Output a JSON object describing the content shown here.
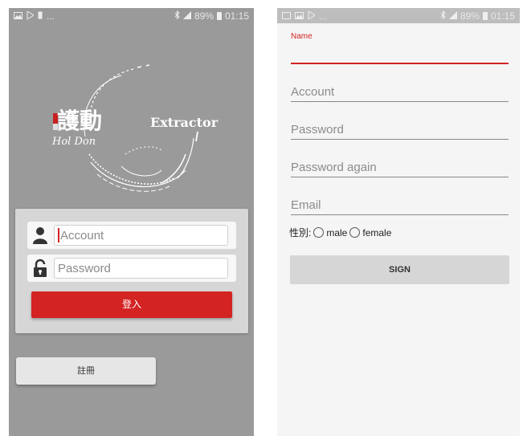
{
  "status_bar_left": {
    "battery": "89%",
    "time": "01:15",
    "dots": "..."
  },
  "status_bar_right": {
    "battery": "89%",
    "time": "01:15",
    "dots": "..."
  },
  "logo": {
    "text_chinese": "護動",
    "text_script": "Hol Don",
    "text_extractor": "Extractor"
  },
  "login": {
    "account_placeholder": "Account",
    "password_placeholder": "Password",
    "login_label": "登入",
    "register_label": "註冊"
  },
  "register_form": {
    "name_label": "Name",
    "account_placeholder": "Account",
    "password_placeholder": "Password",
    "password_again_placeholder": "Password again",
    "email_placeholder": "Email",
    "gender_label": "性別:",
    "male_label": "male",
    "female_label": "female",
    "sign_label": "SIGN"
  },
  "colors": {
    "accent_red": "#d42323",
    "left_bg": "#9a9a9a",
    "right_bg": "#f5f5f5"
  }
}
